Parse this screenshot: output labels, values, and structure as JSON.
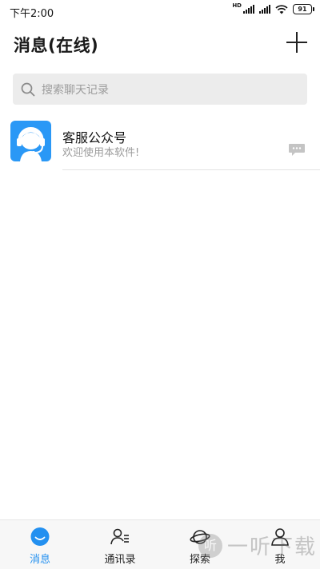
{
  "status_bar": {
    "time": "下午2:00",
    "hd_label": "HD",
    "battery": "91"
  },
  "header": {
    "title": "消息(在线)",
    "add_icon": "plus-icon"
  },
  "search": {
    "placeholder": "搜索聊天记录",
    "icon": "search-icon"
  },
  "conversations": [
    {
      "name": "客服公众号",
      "preview": "欢迎使用本软件!",
      "avatar_icon": "headset-agent-icon",
      "avatar_color": "#2a98f6",
      "action_icon": "chat-bubble-icon"
    }
  ],
  "bottom_nav": {
    "items": [
      {
        "label": "消息",
        "icon": "message-icon",
        "active": true
      },
      {
        "label": "通讯录",
        "icon": "contacts-icon",
        "active": false
      },
      {
        "label": "探索",
        "icon": "planet-icon",
        "active": false
      },
      {
        "label": "我",
        "icon": "user-icon",
        "active": false
      }
    ]
  },
  "watermark": {
    "logo_char": "听",
    "text": "一听下载"
  },
  "colors": {
    "accent": "#2390f0",
    "avatar_bg": "#2a98f6",
    "search_bg": "#ececec",
    "nav_bg": "#f7f7f7",
    "placeholder": "#9b9b9b"
  }
}
